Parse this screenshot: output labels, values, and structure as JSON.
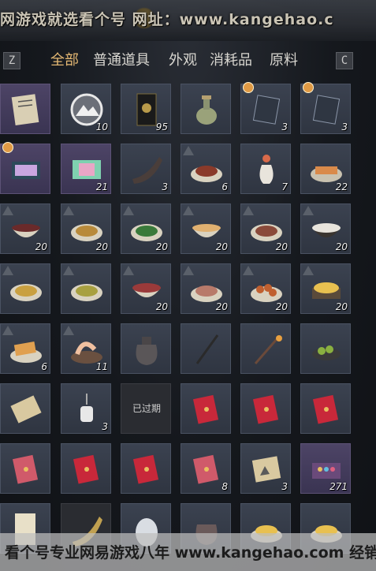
{
  "banner": {
    "text": "网游戏就选看个号 网址：www.kangehao.c"
  },
  "tabbar": {
    "left_key": "Z",
    "right_key": "C",
    "tabs": [
      "全部",
      "普通道具",
      "外观",
      "消耗品",
      "原料"
    ],
    "active_tab": "全部"
  },
  "items": {
    "r1": [
      "",
      "10",
      "95",
      "",
      "3",
      "3"
    ],
    "r2": [
      "",
      "21",
      "3",
      "6",
      "7",
      "22"
    ],
    "r3": [
      "20",
      "20",
      "20",
      "20",
      "20",
      "20"
    ],
    "r4": [
      "",
      "",
      "20",
      "20",
      "20",
      "20"
    ],
    "r5": [
      "6",
      "11",
      "",
      "",
      "",
      ""
    ],
    "r6": [
      "",
      "3",
      "",
      "",
      "",
      ""
    ],
    "r7": [
      "",
      "",
      "",
      "8",
      "3",
      "271"
    ],
    "expired_label": "已过期"
  },
  "footer": {
    "text": "看个号专业网易游戏八年 www.kangehao.com 经销过百亿"
  },
  "colors": {
    "accent_tab": "#e4b873",
    "slot_bg": "#3b4250",
    "slot_purple": "#4d4466"
  }
}
